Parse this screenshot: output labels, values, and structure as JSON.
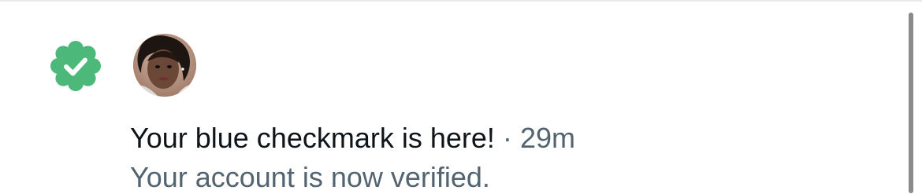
{
  "notification": {
    "badge_icon": "verified-badge-icon",
    "badge_color": "#4cb87a",
    "avatar_icon": "user-avatar",
    "title": "Your blue checkmark is here!",
    "separator": "·",
    "time": "29m",
    "subtitle": "Your account is now verified."
  },
  "colors": {
    "primary_text": "#0f1419",
    "secondary_text": "#536471",
    "divider": "#e7e9ea",
    "scrollbar": "#8b8b8b"
  }
}
